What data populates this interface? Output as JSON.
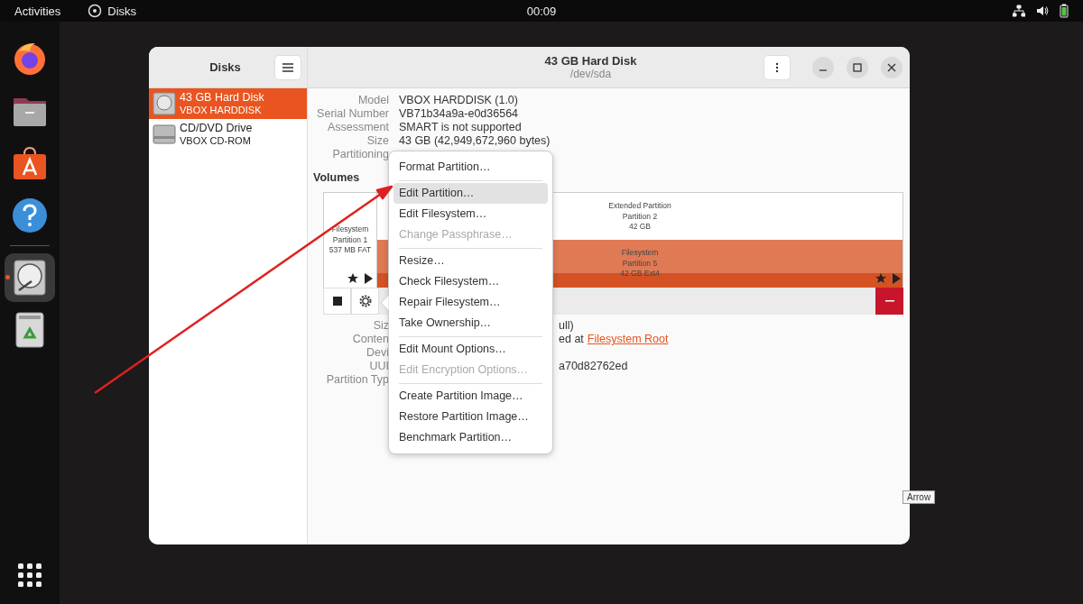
{
  "top_bar": {
    "activities": "Activities",
    "app_name": "Disks",
    "clock": "00:09"
  },
  "dock": [
    {
      "kind": "firefox",
      "selected": false
    },
    {
      "kind": "files",
      "selected": false
    },
    {
      "kind": "software",
      "selected": false
    },
    {
      "kind": "help",
      "selected": false
    },
    {
      "kind": "disks",
      "selected": true
    },
    {
      "kind": "trash",
      "selected": false
    }
  ],
  "sidebar": {
    "title": "Disks",
    "items": [
      {
        "kind": "hdd",
        "title": "43 GB Hard Disk",
        "subtitle": "VBOX HARDDISK",
        "selected": true
      },
      {
        "kind": "optical",
        "title": "CD/DVD Drive",
        "subtitle": "VBOX CD-ROM",
        "selected": false
      }
    ]
  },
  "header": {
    "title": "43 GB Hard Disk",
    "subtitle": "/dev/sda"
  },
  "drive_info": [
    {
      "label": "Model",
      "value": "VBOX HARDDISK (1.0)"
    },
    {
      "label": "Serial Number",
      "value": "VB71b34a9a-e0d36564"
    },
    {
      "label": "Assessment",
      "value": "SMART is not supported"
    },
    {
      "label": "Size",
      "value": "43 GB (42,949,672,960 bytes)"
    },
    {
      "label": "Partitioning"
    }
  ],
  "volumes": {
    "heading": "Volumes",
    "partition_1": {
      "lines": [
        "Filesystem",
        "Partition 1",
        "537 MB FAT"
      ],
      "selected": false
    },
    "extended": {
      "lines": [
        "Extended Partition",
        "Partition 2",
        "42 GB"
      ],
      "selected": false
    },
    "partition_5": {
      "lines": [
        "Filesystem",
        "Partition 5",
        "42 GB Ext4"
      ],
      "selected": true
    }
  },
  "partition_details": [
    {
      "label": "Siz",
      "value": "ull)"
    },
    {
      "label": "Conten",
      "value": "ed at",
      "link": "Filesystem Root"
    },
    {
      "label": "Devi"
    },
    {
      "label": "UUI",
      "value": "a70d82762ed"
    },
    {
      "label": "Partition Typ"
    }
  ],
  "menu": [
    [
      {
        "label": "Format Partition…",
        "selected": false,
        "disabled": false
      }
    ],
    [
      {
        "label": "Edit Partition…",
        "selected": true,
        "disabled": false
      },
      {
        "label": "Edit Filesystem…",
        "selected": false,
        "disabled": false
      },
      {
        "label": "Change Passphrase…",
        "selected": false,
        "disabled": true
      }
    ],
    [
      {
        "label": "Resize…",
        "selected": false,
        "disabled": false
      },
      {
        "label": "Check Filesystem…",
        "selected": false,
        "disabled": false
      },
      {
        "label": "Repair Filesystem…",
        "selected": false,
        "disabled": false
      },
      {
        "label": "Take Ownership…",
        "selected": false,
        "disabled": false
      }
    ],
    [
      {
        "label": "Edit Mount Options…",
        "selected": false,
        "disabled": false
      },
      {
        "label": "Edit Encryption Options…",
        "selected": false,
        "disabled": true
      }
    ],
    [
      {
        "label": "Create Partition Image…",
        "selected": false,
        "disabled": false
      },
      {
        "label": "Restore Partition Image…",
        "selected": false,
        "disabled": false
      },
      {
        "label": "Benchmark Partition…",
        "selected": false,
        "disabled": false
      }
    ]
  ],
  "tooltip": "Arrow"
}
